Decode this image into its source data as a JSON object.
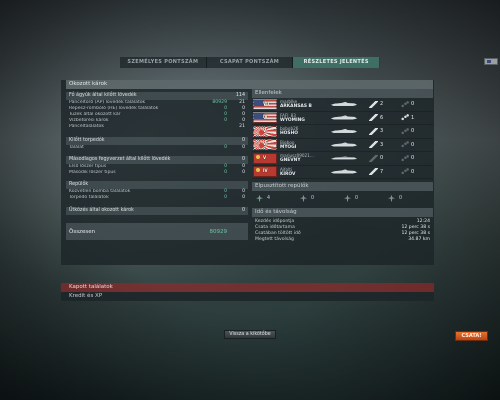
{
  "tabs": [
    {
      "label": "SZEMÉLYES PONTSZÁM",
      "active": false
    },
    {
      "label": "CSAPAT PONTSZÁM",
      "active": false
    },
    {
      "label": "RÉSZLETES JELENTÉS",
      "active": true
    }
  ],
  "header": {
    "title": "Okozott károk"
  },
  "main_guns": {
    "title": "Fő ágyúk által kilőtt lövedék",
    "count": "114",
    "rows": [
      {
        "label": "Páncéltörő (AP) lövedék találatok",
        "damage": "80929",
        "count": "21"
      },
      {
        "label": "Repesz-romboló (HE) lövedék találatok",
        "damage": "0",
        "count": "0"
      },
      {
        "label": "Tüzek által okozott kár",
        "damage": "0",
        "count": "0"
      },
      {
        "label": "Vízbetörési károk",
        "damage": "0",
        "count": "0"
      },
      {
        "label": "Páncéltalálatok",
        "damage": "",
        "count": "21"
      }
    ]
  },
  "torpedoes": {
    "title": "Kilőtt torpedók",
    "count": "0",
    "rows": [
      {
        "label": "Találat",
        "damage": "0",
        "count": "0"
      }
    ]
  },
  "secondary": {
    "title": "Másodlagos fegyverzet által kilőtt lövedék",
    "count": "0",
    "rows": [
      {
        "label": "Első lőszer típus",
        "damage": "0",
        "count": "0"
      },
      {
        "label": "Második lőszer típus",
        "damage": "0",
        "count": "0"
      }
    ]
  },
  "aircraft": {
    "title": "Repülők",
    "rows": [
      {
        "label": "Közvetlen bomba találatok",
        "damage": "0",
        "count": "0"
      },
      {
        "label": "Torpedó találatok",
        "damage": "0",
        "count": "0"
      }
    ]
  },
  "ramming": {
    "title": "Ütközés által okozott károk",
    "count": "0"
  },
  "total": {
    "label": "Összesen",
    "damage": "80929"
  },
  "enemies": {
    "title": "Ellenfelek",
    "ships": [
      {
        "flag": "us",
        "tier": "VII",
        "player": "marblke",
        "name": "ARKANSAS B",
        "v1": "2",
        "v2": "0",
        "dim": false
      },
      {
        "flag": "us",
        "tier": "IV",
        "player": "FAFI_83",
        "name": "WYOMING",
        "v1": "6",
        "v2": "1",
        "dim": false
      },
      {
        "flag": "jp",
        "tier": "V",
        "player": "bobob26",
        "name": "HOSHO",
        "v1": "3",
        "v2": "0",
        "dim": false
      },
      {
        "flag": "jp",
        "tier": "VI",
        "player": "Bigboo",
        "name": "MYOGI",
        "v1": "3",
        "v2": "0",
        "dim": false
      },
      {
        "flag": "su",
        "tier": "V",
        "player": "mariusz09021...",
        "name": "GNEVNY",
        "v1": "0",
        "v2": "0",
        "dim": true
      },
      {
        "flag": "su",
        "tier": "IV",
        "player": "Aifolti",
        "name": "KIROV",
        "v1": "7",
        "v2": "0",
        "dim": false
      }
    ]
  },
  "planes": {
    "title": "Elpusztított repülők",
    "items": [
      {
        "value": "4",
        "icon": "fighter-icon"
      },
      {
        "value": "0",
        "icon": "torpedo-bomber-icon"
      },
      {
        "value": "0",
        "icon": "dive-bomber-icon"
      },
      {
        "value": "0",
        "icon": "scout-plane-icon"
      }
    ]
  },
  "time": {
    "title": "Idő és távolság",
    "rows": [
      {
        "label": "Kezdés időpontja",
        "value": "12:24"
      },
      {
        "label": "Csata időtartama",
        "value": "12 perc 38 s"
      },
      {
        "label": "Csatában töltött idő",
        "value": "12 perc 38 s"
      },
      {
        "label": "Megtett távolság",
        "value": "34.87 km"
      }
    ]
  },
  "received": {
    "label": "Kapott találatok"
  },
  "credits": {
    "label": "Kredit és XP"
  },
  "buttons": {
    "back": "Vissza a kikötőbe",
    "battle": "CSATA!"
  },
  "colors": {
    "accent_green": "#6cc4a6",
    "active_tab": "#3e6e64",
    "battle_button": "#e9712e",
    "received_bar": "#962828"
  }
}
